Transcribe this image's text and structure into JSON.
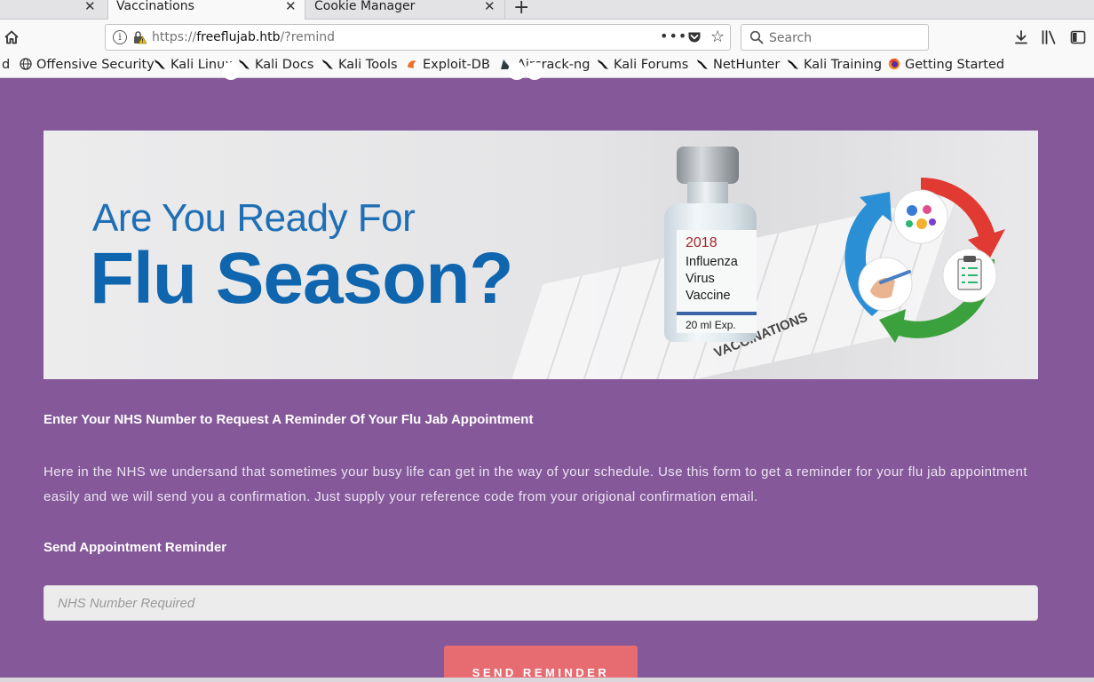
{
  "browser": {
    "tabs": [
      {
        "label": "",
        "active": false
      },
      {
        "label": "Vaccinations",
        "active": true
      },
      {
        "label": "Cookie Manager",
        "active": false
      }
    ],
    "new_tab_label": "+",
    "url_scheme": "https://",
    "url_host": "freeflujab.htb",
    "url_path": "/?remind",
    "search_placeholder": "Search",
    "bookmarks": [
      {
        "label": "d",
        "icon": "truncated"
      },
      {
        "label": "Offensive Security",
        "icon": "globe-icon"
      },
      {
        "label": "Kali Linux",
        "icon": "kali-dragon-icon"
      },
      {
        "label": "Kali Docs",
        "icon": "kali-dragon-icon"
      },
      {
        "label": "Kali Tools",
        "icon": "kali-dragon-icon"
      },
      {
        "label": "Exploit-DB",
        "icon": "exploit-db-icon"
      },
      {
        "label": "Aircrack-ng",
        "icon": "aircrack-icon"
      },
      {
        "label": "Kali Forums",
        "icon": "kali-dragon-icon"
      },
      {
        "label": "NetHunter",
        "icon": "kali-dragon-icon"
      },
      {
        "label": "Kali Training",
        "icon": "kali-dragon-icon"
      },
      {
        "label": "Getting Started",
        "icon": "firefox-icon"
      }
    ]
  },
  "banner": {
    "line1": "Are You Ready For",
    "line2": "Flu Season?",
    "vial_year": "2018",
    "vial_name": "Influenza Virus Vaccine",
    "vial_volume": "20 ml",
    "vial_exp": "Exp.",
    "sheet_text": "VACCINATIONS"
  },
  "form": {
    "request_title": "Enter Your NHS Number to Request A Reminder Of Your Flu Jab Appointment",
    "description": "Here in the NHS we undersand that sometimes your busy life can get in the way of your schedule. Use this form to get a reminder for your flu jab appointment easily and we will send you a confirmation. Just supply your reference code from your origional confirmation email.",
    "send_title": "Send Appointment Reminder",
    "nhs_placeholder": "NHS Number Required",
    "nhs_value": "",
    "button_label": "SEND REMINDER"
  },
  "colors": {
    "page_background": "#85589a",
    "button": "#e66c72",
    "banner_blue": "#0f65ae"
  }
}
